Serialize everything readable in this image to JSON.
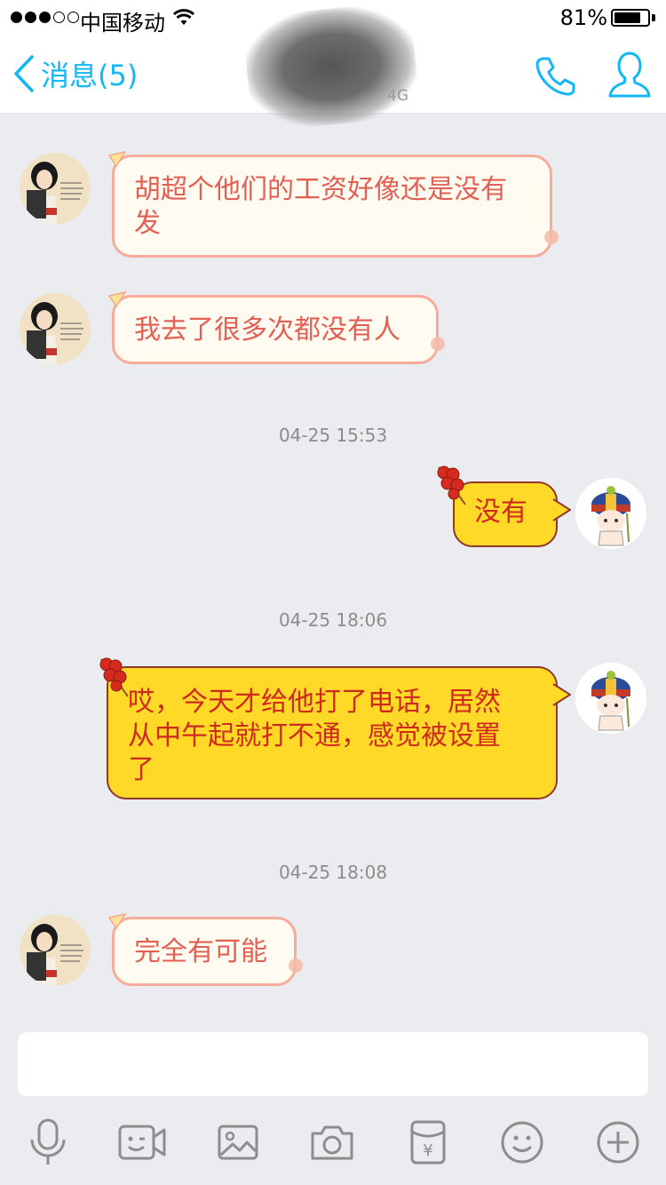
{
  "status_bar": {
    "signal_dots_filled": 3,
    "signal_dots_total": 5,
    "carrier": "中国移动",
    "battery_text": "81%",
    "battery_level": 0.81
  },
  "nav": {
    "back_label": "消息(5)",
    "subtitle": "4G",
    "accent": "#12b7f5",
    "call_icon": "phone-icon",
    "profile_icon": "person-icon"
  },
  "messages": [
    {
      "side": "left",
      "text_line1": "胡超个他们的工资好像还是没有",
      "text_line2": "发"
    },
    {
      "side": "left",
      "text": "我去了很多次都没有人"
    },
    {
      "type": "time",
      "text": "04-25 15:53"
    },
    {
      "side": "right",
      "text": "没有"
    },
    {
      "type": "time",
      "text": "04-25 18:06"
    },
    {
      "side": "right",
      "text_line1": "哎，今天才给他打了电话，居然",
      "text_line2": "从中午起就打不通，感觉被设置",
      "text_line3": "了"
    },
    {
      "type": "time",
      "text": "04-25 18:08"
    },
    {
      "side": "left",
      "text": "完全有可能"
    }
  ],
  "input": {
    "placeholder": ""
  },
  "toolbar": [
    {
      "icon": "microphone-icon"
    },
    {
      "icon": "video-call-icon"
    },
    {
      "icon": "image-icon"
    },
    {
      "icon": "camera-icon"
    },
    {
      "icon": "red-packet-icon",
      "glyph": "¥"
    },
    {
      "icon": "emoji-icon"
    },
    {
      "icon": "plus-icon"
    }
  ],
  "colors": {
    "background": "#ebecf0",
    "incoming_bubble": "#fffbf1",
    "incoming_text": "#e26053",
    "outgoing_bubble": "#ffd928",
    "outgoing_text": "#cf2b1c",
    "timestamp_text": "#8c8c8c"
  }
}
